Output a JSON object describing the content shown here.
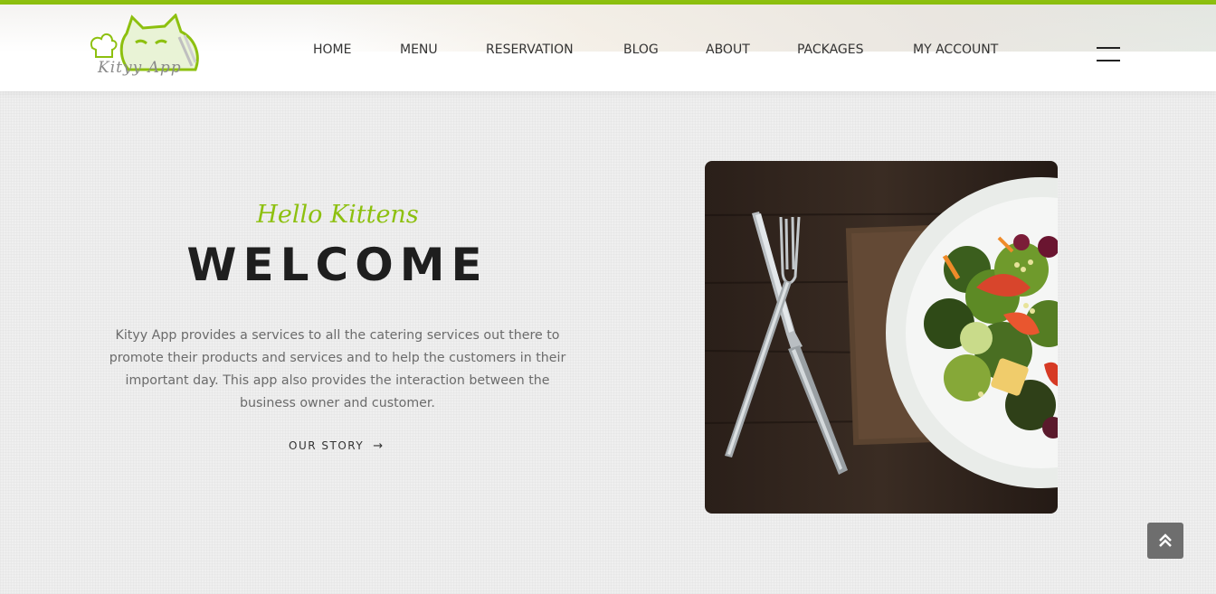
{
  "brand": {
    "logo_name": "Kityy App"
  },
  "nav": {
    "items": [
      {
        "label": "HOME"
      },
      {
        "label": "MENU"
      },
      {
        "label": "RESERVATION"
      },
      {
        "label": "BLOG"
      },
      {
        "label": "ABOUT"
      },
      {
        "label": "PACKAGES"
      },
      {
        "label": "MY ACCOUNT"
      }
    ]
  },
  "hero": {
    "kicker": "Hello Kittens",
    "title": "WELCOME",
    "description": "Kityy App provides a services to all the catering services out there to promote their products and services and to help the customers in their important day. This app also provides the interaction between the business owner and customer.",
    "cta_label": "OUR STORY",
    "cta_arrow": "→"
  },
  "icons": {
    "menu": "hamburger-icon",
    "cta": "arrow-right-icon",
    "scroll_top": "double-chevron-up-icon"
  },
  "colors": {
    "accent": "#8dc00f",
    "heading": "#1e1e1e",
    "text": "#6b6b6b",
    "scroll_button": "#6e6e6e"
  }
}
